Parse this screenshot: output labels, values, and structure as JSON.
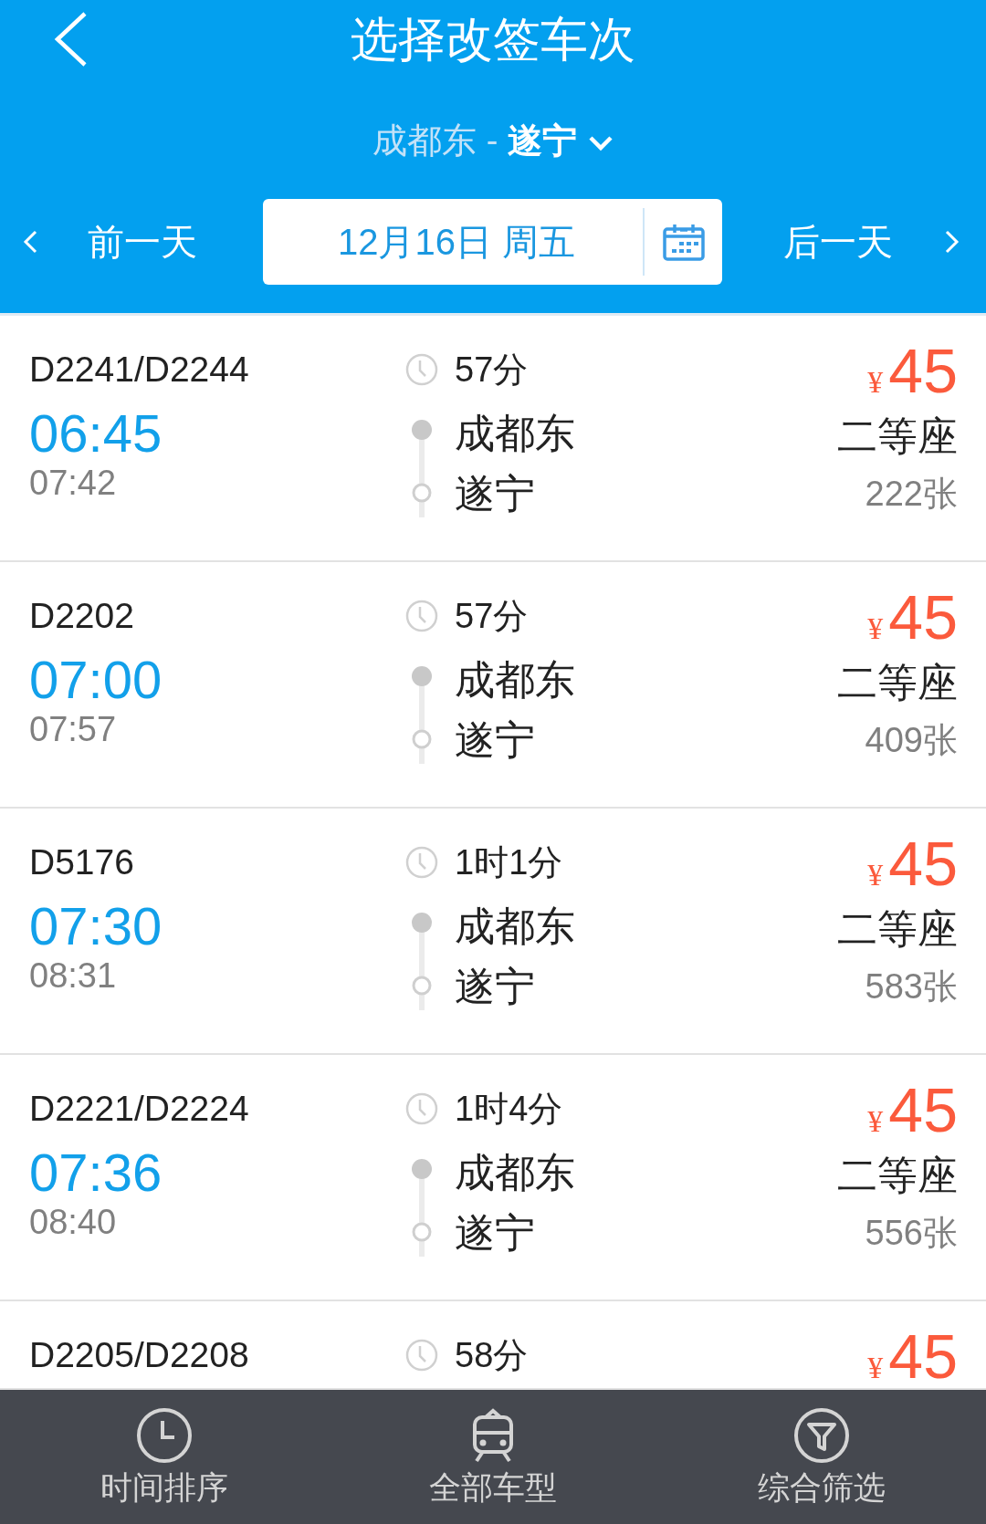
{
  "header": {
    "title": "选择改签车次",
    "route": {
      "from": "成都东",
      "separator": "-",
      "to": "遂宁"
    }
  },
  "date_bar": {
    "previous": "前一天",
    "date": "12月16日 周五",
    "next": "后一天"
  },
  "trains": [
    {
      "number": "D2241/D2244",
      "depart": "06:45",
      "arrive": "07:42",
      "duration": "57分",
      "from": "成都东",
      "to": "遂宁",
      "currency": "¥",
      "price": "45",
      "seat": "二等座",
      "count": "222张"
    },
    {
      "number": "D2202",
      "depart": "07:00",
      "arrive": "07:57",
      "duration": "57分",
      "from": "成都东",
      "to": "遂宁",
      "currency": "¥",
      "price": "45",
      "seat": "二等座",
      "count": "409张"
    },
    {
      "number": "D5176",
      "depart": "07:30",
      "arrive": "08:31",
      "duration": "1时1分",
      "from": "成都东",
      "to": "遂宁",
      "currency": "¥",
      "price": "45",
      "seat": "二等座",
      "count": "583张"
    },
    {
      "number": "D2221/D2224",
      "depart": "07:36",
      "arrive": "08:40",
      "duration": "1时4分",
      "from": "成都东",
      "to": "遂宁",
      "currency": "¥",
      "price": "45",
      "seat": "二等座",
      "count": "556张"
    },
    {
      "number": "D2205/D2208",
      "duration": "58分",
      "currency": "¥",
      "price": "45"
    }
  ],
  "toolbar": [
    {
      "kind": "clock",
      "label": "时间排序"
    },
    {
      "kind": "train",
      "label": "全部车型"
    },
    {
      "kind": "filter",
      "label": "综合筛选"
    }
  ]
}
